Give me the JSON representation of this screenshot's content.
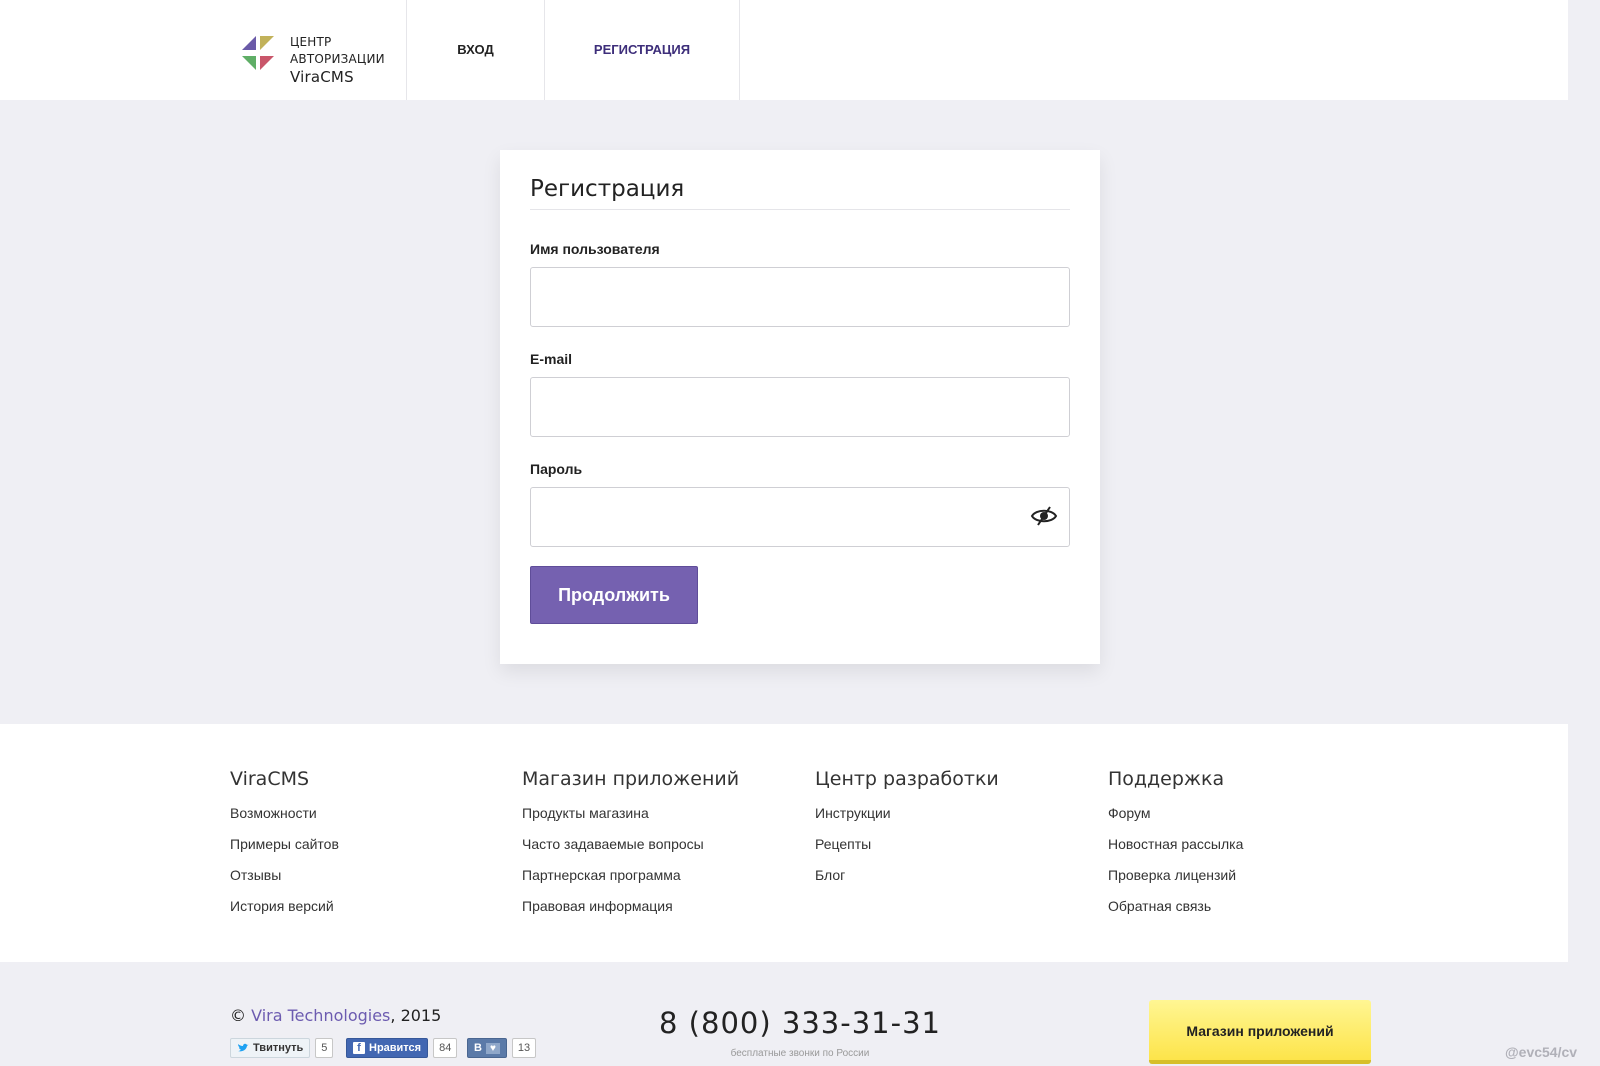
{
  "header": {
    "logo": {
      "line1": "ЦЕНТР",
      "line2": "АВТОРИЗАЦИИ",
      "brand": "ViraCMS"
    },
    "nav": {
      "login": "ВХОД",
      "register": "РЕГИСТРАЦИЯ"
    }
  },
  "form": {
    "title": "Регистрация",
    "username_label": "Имя пользователя",
    "username_value": "",
    "email_label": "E-mail",
    "email_value": "",
    "password_label": "Пароль",
    "password_value": "",
    "submit_label": "Продолжить"
  },
  "footer": {
    "columns": [
      {
        "title": "ViraCMS",
        "links": [
          "Возможности",
          "Примеры сайтов",
          "Отзывы",
          "История версий"
        ]
      },
      {
        "title": "Магазин приложений",
        "links": [
          "Продукты магазина",
          "Часто задаваемые вопросы",
          "Партнерская программа",
          "Правовая информация"
        ]
      },
      {
        "title": "Центр разработки",
        "links": [
          "Инструкции",
          "Рецепты",
          "Блог"
        ]
      },
      {
        "title": "Поддержка",
        "links": [
          "Форум",
          "Новостная рассылка",
          "Проверка лицензий",
          "Обратная связь"
        ]
      }
    ]
  },
  "bottom": {
    "copyright_symbol": "©",
    "company": "Vira Technologies",
    "year": ", 2015",
    "social": {
      "twitter_label": "Твитнуть",
      "twitter_count": "5",
      "facebook_label": "Нравится",
      "facebook_count": "84",
      "vk_label": "В",
      "vk_count": "13"
    },
    "phone": "8 (800) 333-31-31",
    "phone_note": "бесплатные звонки по России",
    "store_button": "Магазин приложений"
  },
  "watermark": "@evc54/cv",
  "colors": {
    "accent": "#7561b0",
    "nav_active": "#3d2e7a",
    "store_button": "#fde44a",
    "background": "#efeff4"
  }
}
